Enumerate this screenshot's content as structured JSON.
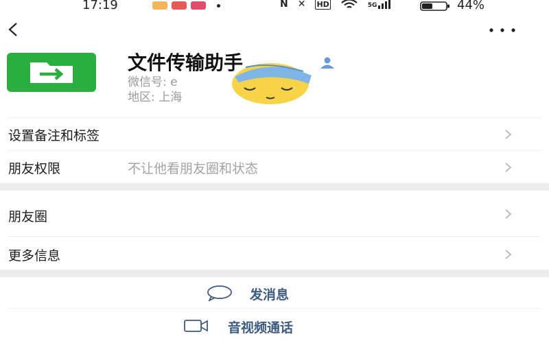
{
  "status_bar": {
    "time": "17:19",
    "network": "5G",
    "battery_percent": "44%",
    "battery_level": 0.44
  },
  "nav": {
    "back_icon": "chevron-left-icon",
    "more_icon": "more-dots-icon"
  },
  "profile": {
    "name": "文件传输助手",
    "wechat_id": "微信号: e",
    "region": "地区: 上海",
    "avatar_icon": "file-transfer-icon",
    "avatar_color": "#2aae3f"
  },
  "rows": [
    {
      "label": "设置备注和标签",
      "value": ""
    },
    {
      "label": "朋友权限",
      "value": "不让他看朋友圈和状态"
    },
    {
      "label": "朋友圈",
      "value": ""
    },
    {
      "label": "更多信息",
      "value": ""
    }
  ],
  "actions": {
    "send_message": "发消息",
    "video_call": "音视频通话"
  },
  "colors": {
    "action_text": "#3d5a80",
    "secondary_text": "#a3a3a3",
    "section_gap": "#ededed"
  }
}
